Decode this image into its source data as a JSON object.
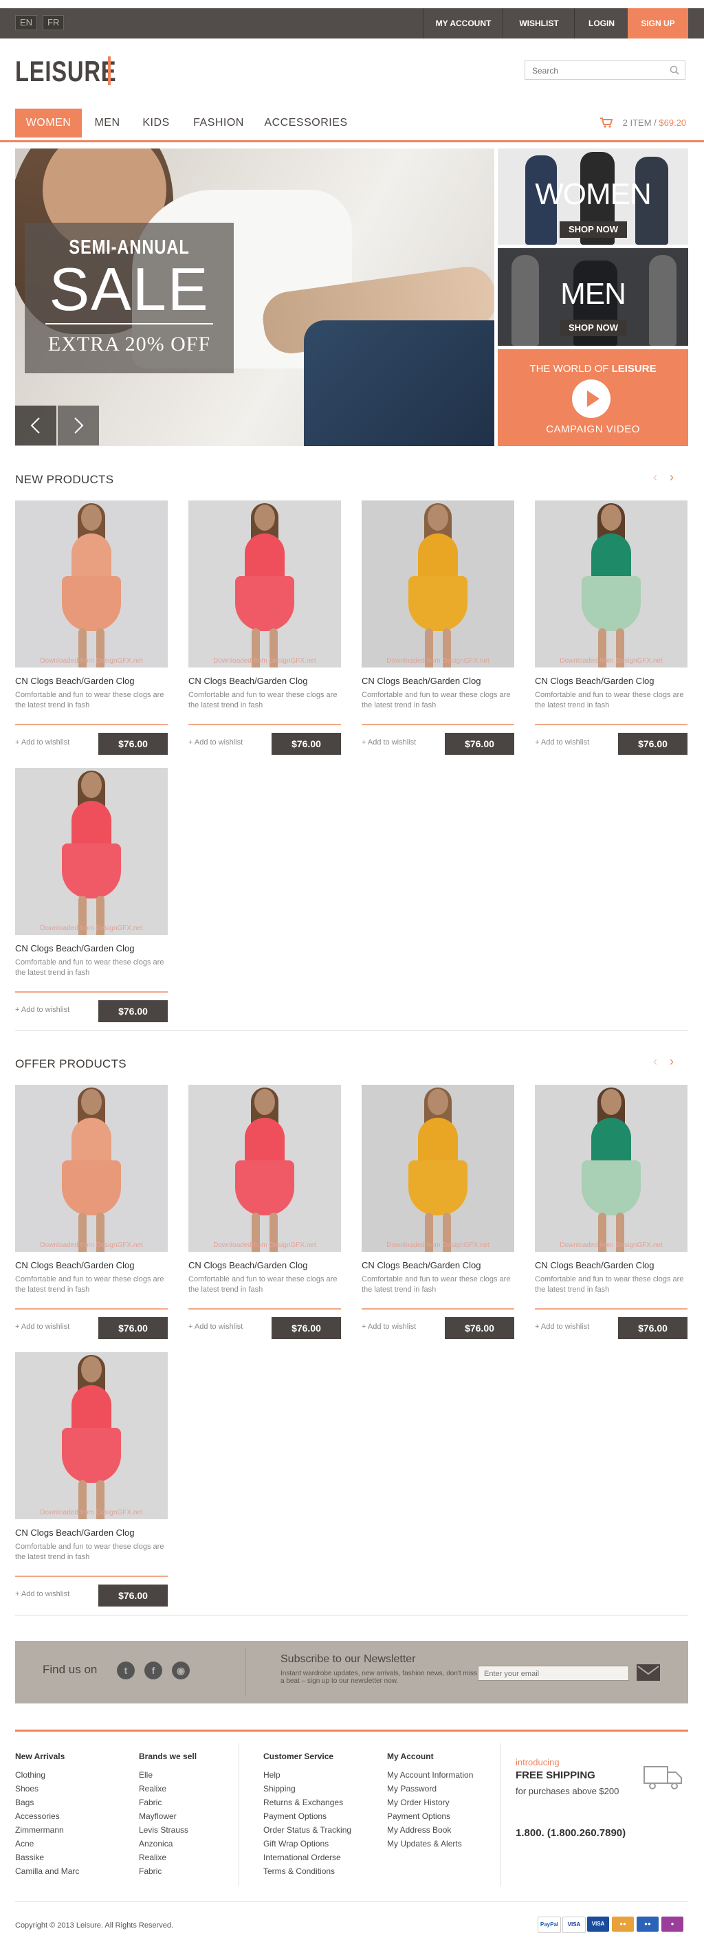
{
  "top": {
    "langs": [
      "EN",
      "FR"
    ],
    "nav": [
      "MY ACCOUNT",
      "WISHLIST",
      "LOGIN",
      "SIGN UP"
    ]
  },
  "header": {
    "logo": "LEISURE",
    "search_placeholder": "Search"
  },
  "mainnav": {
    "items": [
      "WOMEN",
      "MEN",
      "KIDS",
      "FASHION",
      "ACCESSORIES"
    ],
    "cart_items": "2 ITEM /",
    "cart_amount": "$69.20"
  },
  "hero": {
    "line1": "SEMI-ANNUAL",
    "line2": "SALE",
    "line3": "EXTRA 20% OFF"
  },
  "banners": {
    "women": "WOMEN",
    "men": "MEN",
    "shop": "SHOP NOW",
    "camp_top_a": "THE WORLD OF",
    "camp_top_b": "LEISURE",
    "camp_bottom": "CAMPAIGN VIDEO"
  },
  "sections": {
    "new": "NEW PRODUCTS",
    "offer": "OFFER PRODUCTS"
  },
  "product": {
    "name": "CN Clogs Beach/Garden Clog",
    "desc": "Comfortable and fun to wear these clogs are the latest trend in fash",
    "wish": "+ Add to wishlist",
    "price": "$76.00",
    "watermark": "Downloaded from DesignGFX.net"
  },
  "newsletter": {
    "find": "Find us on",
    "title": "Subscribe to our Newsletter",
    "text": "Instant wardrobe updates, new arrivals, fashion news, don't miss a beat – sign up to our newsletter now.",
    "placeholder": "Enter your email"
  },
  "footer": {
    "col1": {
      "title": "New Arrivals",
      "items": [
        "Clothing",
        "Shoes",
        "Bags",
        "Accessories",
        "Zimmermann",
        "Acne",
        "Bassike",
        "Camilla and Marc"
      ]
    },
    "col2": {
      "title": "Brands we sell",
      "items": [
        "Elle",
        "Realixe",
        "Fabric",
        "Mayflower",
        "Levis Strauss",
        "Anzonica",
        "Realixe",
        "Fabric"
      ]
    },
    "col3": {
      "title": "Customer Service",
      "items": [
        "Help",
        "Shipping",
        "Returns & Exchanges",
        "Payment Options",
        "Order Status & Tracking",
        "Gift Wrap Options",
        "International Orderse",
        "Terms & Conditions"
      ]
    },
    "col4": {
      "title": "My Account",
      "items": [
        "My Account Information",
        "My Password",
        "My Order History",
        "Payment Options",
        "My Address Book",
        "My Updates & Alerts"
      ]
    },
    "ship_intro": "introducing",
    "ship_title": "FREE SHIPPING",
    "ship_text": "for purchases above $200",
    "phone": "1.800. (1.800.260.7890)",
    "copyright": "Copyright © 2013 Leisure. All Rights Reserved.",
    "payments": [
      "PayPal",
      "VISA",
      "VISA Electron",
      "Maestro",
      "MasterCard",
      "other"
    ]
  },
  "colors": {
    "accent": "#f0845c",
    "dark": "#4a4542",
    "topbar": "#524d4a"
  }
}
